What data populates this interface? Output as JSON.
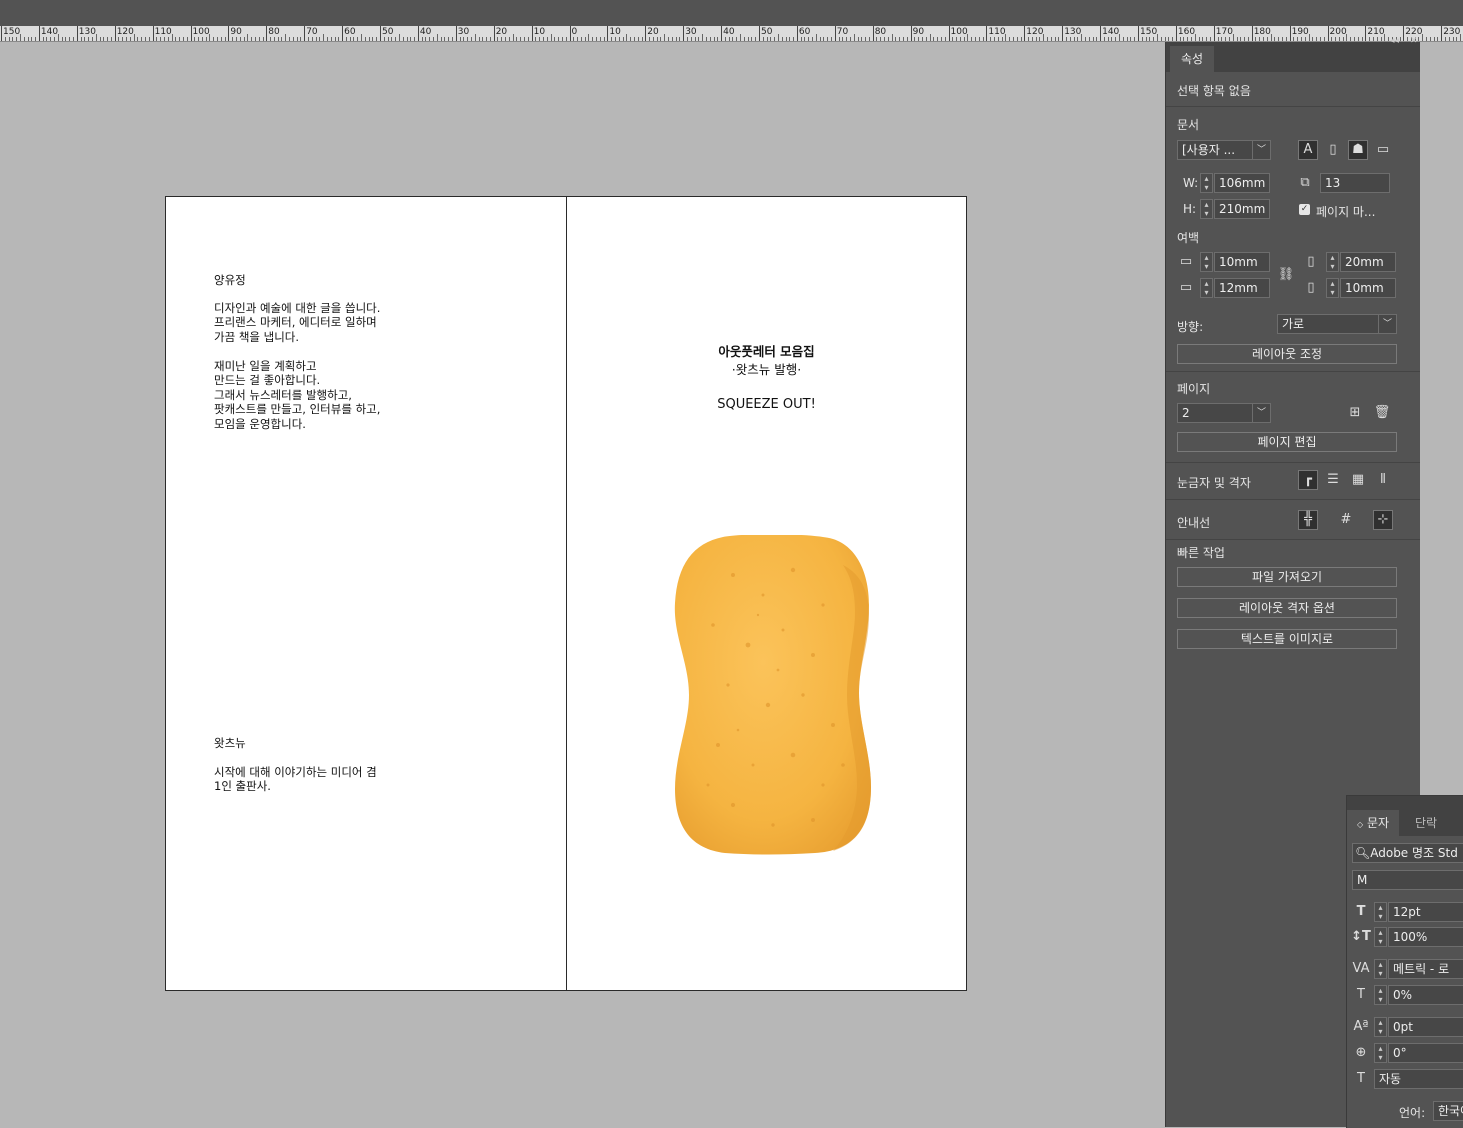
{
  "ruler": {
    "labels": [
      "150",
      "140",
      "130",
      "120",
      "110",
      "100",
      "90",
      "80",
      "70",
      "60",
      "50",
      "40",
      "30",
      "20",
      "10",
      "0",
      "10",
      "20",
      "30",
      "40",
      "50",
      "60",
      "70",
      "80",
      "90",
      "100",
      "110",
      "120",
      "130",
      "140",
      "150",
      "160",
      "170",
      "180",
      "190",
      "200",
      "210",
      "220",
      "230"
    ]
  },
  "spread": {
    "left_page": {
      "author_name": "양유정",
      "author_bio": "디자인과 예술에 대한 글을 씁니다.\n프리랜스 마케터, 에디터로 일하며\n가끔 책을 냅니다.",
      "author_bio2": "재미난 일을 계획하고\n만드는 걸 좋아합니다.\n그래서 뉴스레터를 발행하고,\n팟캐스트를 만들고, 인터뷰를 하고,\n모임을 운영합니다.",
      "publisher_name": "왓츠뉴",
      "publisher_desc": "시작에 대해 이야기하는 미디어 겸\n1인 출판사."
    },
    "right_page": {
      "title": "아웃풋레터 모음집",
      "subtitle": "·왓츠뉴 발행·",
      "tagline": "SQUEEZE OUT!",
      "image_alt": "yellow-sponge"
    }
  },
  "properties_panel": {
    "tab_label": "속성",
    "collapse_icon": "double-chevron-left-icon",
    "close_icon": "close-icon",
    "selection_status": "선택 항목 없음",
    "document": {
      "section_label": "문서",
      "preset_value": "[사용자 ...",
      "width_label": "W:",
      "width_value": "106mm",
      "height_label": "H:",
      "height_value": "210mm",
      "pages_value": "13",
      "facing_pages_label": "페이지 마...",
      "facing_pages_checked": true
    },
    "margins": {
      "section_label": "여백",
      "top": "10mm",
      "bottom": "12mm",
      "inside": "20mm",
      "outside": "10mm"
    },
    "orientation": {
      "label": "방향:",
      "value": "가로"
    },
    "adjust_layout_button": "레이아웃 조정",
    "page": {
      "section_label": "페이지",
      "current_page": "2",
      "edit_page_button": "페이지 편집"
    },
    "rulers_grids_label": "눈금자 및 격자",
    "guides_label": "안내선",
    "quick_actions": {
      "section_label": "빠른 작업",
      "buttons": [
        "파일 가져오기",
        "레이아웃 격자 옵션",
        "텍스트를 이미지로"
      ]
    }
  },
  "character_panel": {
    "tabs": [
      "문자",
      "단락"
    ],
    "font_family": "Adobe 명조 Std",
    "font_style": "M",
    "font_size": "12pt",
    "vertical_scale": "100%",
    "kerning": "메트릭 - 로",
    "tracking_shift": "0%",
    "baseline_shift": "0pt",
    "rotation": "0°",
    "leading": "자동",
    "language_label": "언어:",
    "language_value": "한국어"
  },
  "colors": {
    "workspace_bg": "#b7b7b7",
    "panel_bg": "#535353",
    "sponge": "#f5b441"
  }
}
